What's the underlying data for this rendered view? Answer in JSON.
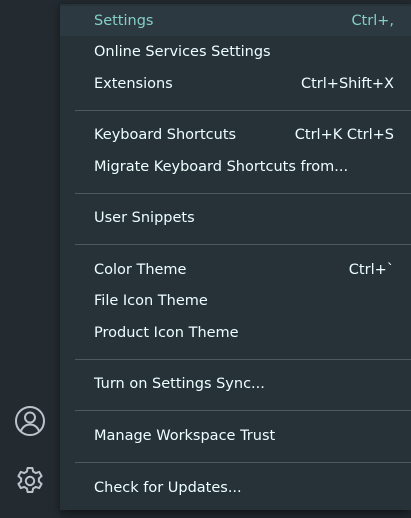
{
  "activity_bar": {
    "account_icon": "account-icon",
    "manage_icon": "gear-icon"
  },
  "menu": {
    "items": [
      {
        "label": "Settings",
        "shortcut": "Ctrl+,"
      },
      {
        "label": "Online Services Settings",
        "shortcut": ""
      },
      {
        "label": "Extensions",
        "shortcut": "Ctrl+Shift+X"
      },
      {
        "label": "Keyboard Shortcuts",
        "shortcut": "Ctrl+K Ctrl+S"
      },
      {
        "label": "Migrate Keyboard Shortcuts from...",
        "shortcut": ""
      },
      {
        "label": "User Snippets",
        "shortcut": ""
      },
      {
        "label": "Color Theme",
        "shortcut": "Ctrl+`"
      },
      {
        "label": "File Icon Theme",
        "shortcut": ""
      },
      {
        "label": "Product Icon Theme",
        "shortcut": ""
      },
      {
        "label": "Turn on Settings Sync...",
        "shortcut": ""
      },
      {
        "label": "Manage Workspace Trust",
        "shortcut": ""
      },
      {
        "label": "Check for Updates...",
        "shortcut": ""
      }
    ]
  },
  "colors": {
    "menu_background": "#263238",
    "highlight_background": "#2c3940",
    "highlight_text": "#84cfc7",
    "text": "#eeffff",
    "separator": "#4c5a60"
  }
}
